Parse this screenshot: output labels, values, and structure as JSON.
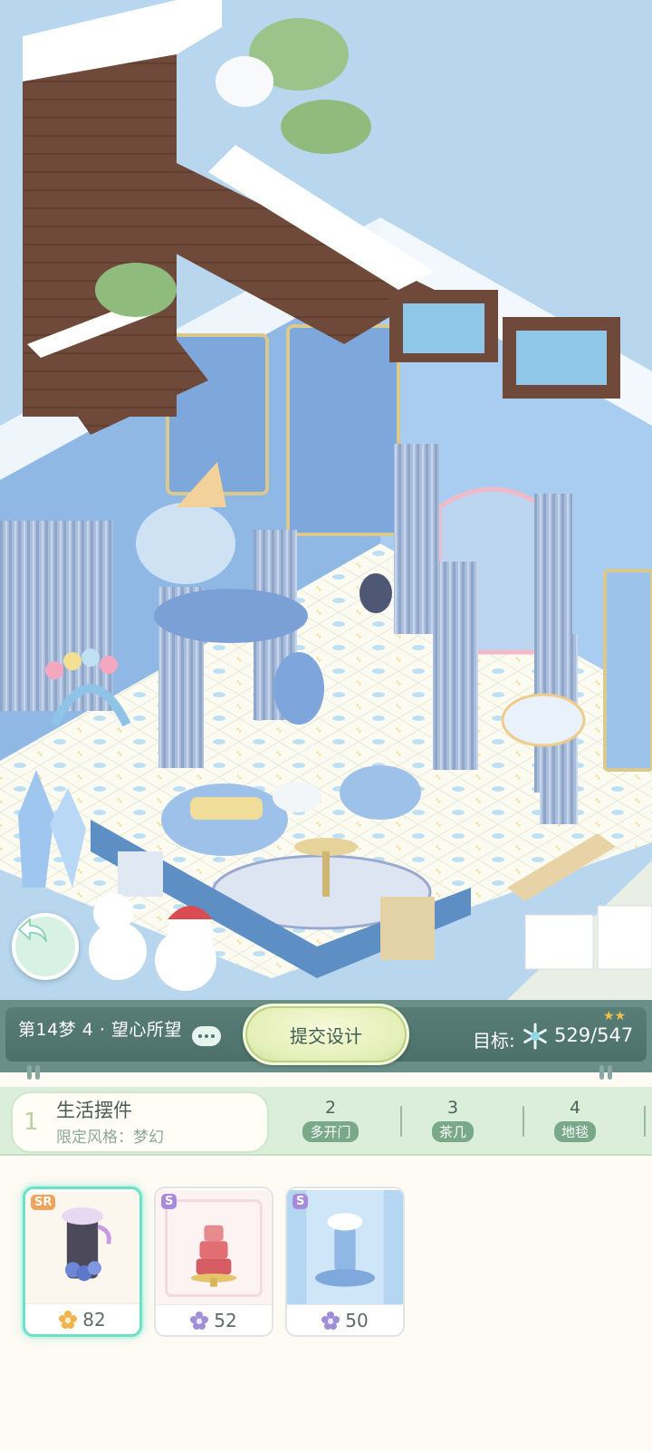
{
  "scene": {
    "description_icons": [
      "back-arrow-icon"
    ]
  },
  "status": {
    "level_label": "第14梦 4 · 望心所望",
    "submit_label": "提交设计",
    "target_label": "目标:",
    "target_value": "529/547",
    "stars": "★★"
  },
  "tabs": {
    "active": {
      "index": "1",
      "title": "生活摆件",
      "subtitle": "限定风格：梦幻"
    },
    "items": [
      {
        "index": "2",
        "label": "多开门"
      },
      {
        "index": "3",
        "label": "茶几"
      },
      {
        "index": "4",
        "label": "地毯"
      }
    ]
  },
  "items": [
    {
      "rarity": "SR",
      "value": "82",
      "rarity_color": "#f0a35a",
      "currency_color": "#f2b44d",
      "selected": true
    },
    {
      "rarity": "S",
      "value": "52",
      "rarity_color": "#a78ad9",
      "currency_color": "#9f8fd8",
      "selected": false
    },
    {
      "rarity": "S",
      "value": "50",
      "rarity_color": "#a78ad9",
      "currency_color": "#9f8fd8",
      "selected": false
    }
  ],
  "colors": {
    "accent": "#6ee0c6",
    "panel": "#4c706a",
    "tabs_bg": "#dbeeda"
  }
}
